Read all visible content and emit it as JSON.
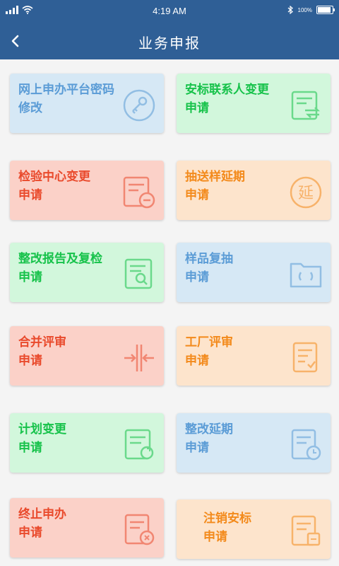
{
  "status": {
    "time": "4:19 AM",
    "battery": "100%"
  },
  "nav": {
    "title": "业务申报"
  },
  "cards": [
    {
      "line1": "网上申办平台密码",
      "line2": "修改",
      "icon": "key-icon",
      "color": "#5b9cd6"
    },
    {
      "line1": "安标联系人变更",
      "line2": "申请",
      "icon": "document-exchange-icon",
      "color": "#16c24a"
    },
    {
      "line1": "检验中心变更",
      "line2": "申请",
      "icon": "document-minus-icon",
      "color": "#e94a2c"
    },
    {
      "line1": "抽送样延期",
      "line2": "申请",
      "icon": "extension-seal-icon",
      "color": "#f38a1b",
      "icon_text": "延"
    },
    {
      "line1": "整改报告及复检",
      "line2": "申请",
      "icon": "document-search-icon",
      "color": "#16c24a"
    },
    {
      "line1": "样品复抽",
      "line2": "申请",
      "icon": "folder-refresh-icon",
      "color": "#5b9cd6"
    },
    {
      "line1": "合并评审",
      "line2": "申请",
      "icon": "merge-icon",
      "color": "#e94a2c"
    },
    {
      "line1": "工厂评审",
      "line2": "申请",
      "icon": "document-check-icon",
      "color": "#f38a1b"
    },
    {
      "line1": "计划变更",
      "line2": "申请",
      "icon": "document-refresh-icon",
      "color": "#16c24a"
    },
    {
      "line1": "整改延期",
      "line2": "申请",
      "icon": "document-clock-icon",
      "color": "#5b9cd6"
    },
    {
      "line1": "终止申办",
      "line2": "申请",
      "icon": "document-stop-icon",
      "color": "#e94a2c"
    },
    {
      "line1": "注销安标",
      "line2": "申请",
      "icon": "document-cancel-icon",
      "color": "#f38a1b"
    }
  ]
}
